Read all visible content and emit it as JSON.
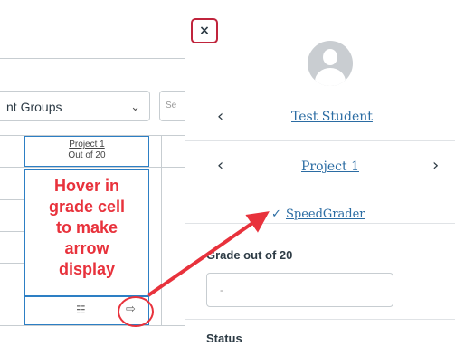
{
  "gradebook": {
    "filter_select": {
      "value": "nt Groups"
    },
    "search": {
      "placeholder": "Se"
    },
    "assignment_column": {
      "name": "Project 1",
      "subtitle": "Out of 20"
    },
    "annotation_lines": [
      "Hover in",
      "grade cell",
      "to make",
      "arrow",
      "display"
    ],
    "cell_icons": {
      "details": "notes-icon",
      "open_tray": "arrow-into-box-icon"
    }
  },
  "tray": {
    "close_label": "×",
    "student_name": "Test Student",
    "assignment_name": "Project 1",
    "speedgrader_label": "SpeedGrader",
    "grade_label": "Grade out of 20",
    "grade_value": "-",
    "status_label": "Status"
  },
  "colors": {
    "annotation_red": "#e8323c",
    "link_blue": "#2b6ca3",
    "selection_blue": "#2d7fc4"
  }
}
